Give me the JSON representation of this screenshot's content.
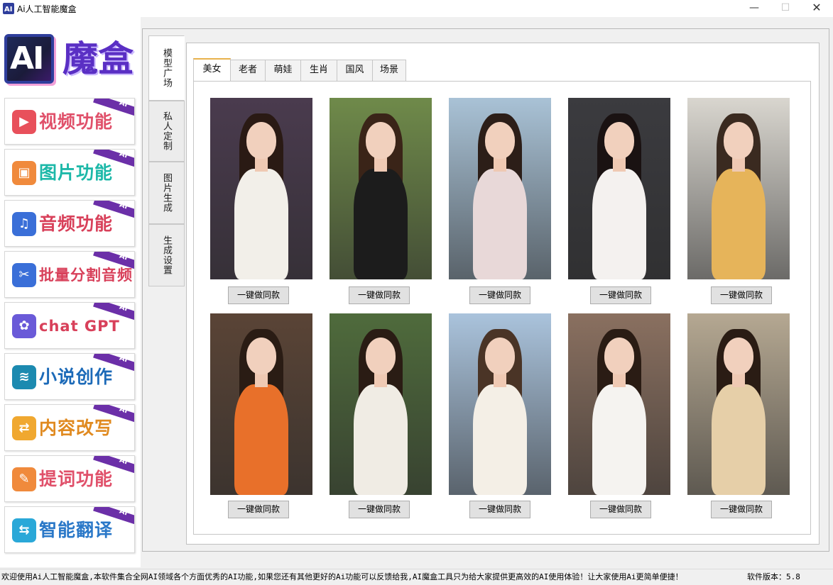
{
  "window": {
    "title": "Ai人工智能魔盒",
    "minimize_icon": "minimize-icon",
    "maximize_icon": "maximize-icon",
    "close_icon": "close-icon"
  },
  "logo": {
    "badge": "AI",
    "name": "魔盒"
  },
  "sidebar": {
    "badge": "AI",
    "items": [
      {
        "label": "视频功能",
        "icon": "video-icon",
        "color": "#e8505b",
        "text_color": "#e0506a"
      },
      {
        "label": "图片功能",
        "icon": "image-icon",
        "color": "#f08a3c",
        "text_color": "#1cb8a8"
      },
      {
        "label": "音频功能",
        "icon": "music-icon",
        "color": "#3a6fd8",
        "text_color": "#d8405a"
      },
      {
        "label": "批量分割音频",
        "icon": "split-audio-icon",
        "color": "#3a6fd8",
        "text_color": "#d8405a"
      },
      {
        "label": "chat GPT",
        "icon": "gpt-icon",
        "color": "#6a5ad8",
        "text_color": "#d8405a"
      },
      {
        "label": "小说创作",
        "icon": "novel-icon",
        "color": "#1c8ab0",
        "text_color": "#1c6ab8"
      },
      {
        "label": "内容改写",
        "icon": "rewrite-icon",
        "color": "#f0a830",
        "text_color": "#e08a20"
      },
      {
        "label": "提词功能",
        "icon": "prompt-icon",
        "color": "#f08a3c",
        "text_color": "#e0506a"
      },
      {
        "label": "智能翻译",
        "icon": "translate-icon",
        "color": "#2aa8d8",
        "text_color": "#2a78c8"
      }
    ]
  },
  "vertical_tabs": [
    "模型广场",
    "私人定制",
    "图片生成",
    "生成设置"
  ],
  "category_tabs": [
    "美女",
    "老者",
    "萌娃",
    "生肖",
    "国风",
    "场景"
  ],
  "gallery": {
    "button_label": "一键做同款",
    "items": [
      {
        "bg": "#4a3b4e",
        "hair": "#2a1a14",
        "outfit": "#f2efe9"
      },
      {
        "bg": "#6f8a4a",
        "hair": "#3a2418",
        "outfit": "#1c1c1c"
      },
      {
        "bg": "#a9c2d6",
        "hair": "#2c1e18",
        "outfit": "#e8d8d8"
      },
      {
        "bg": "#3b3b3f",
        "hair": "#1a1212",
        "outfit": "#f4f1ef"
      },
      {
        "bg": "#d9d6cf",
        "hair": "#3a2a20",
        "outfit": "#e6b45a"
      },
      {
        "bg": "#5a4436",
        "hair": "#2a1c14",
        "outfit": "#e8702a"
      },
      {
        "bg": "#4f6b3c",
        "hair": "#2a1c14",
        "outfit": "#f0ece4"
      },
      {
        "bg": "#aac3dc",
        "hair": "#4a3426",
        "outfit": "#f4efe6"
      },
      {
        "bg": "#8a7060",
        "hair": "#2a1c14",
        "outfit": "#f5f3f0"
      },
      {
        "bg": "#b5a892",
        "hair": "#2a1c14",
        "outfit": "#e6cfa8"
      }
    ]
  },
  "status": {
    "message": "欢迎使用Ai人工智能魔盒,本软件集合全网AI领域各个方面优秀的AI功能,如果您还有其他更好的Ai功能可以反馈给我,AI魔盒工具只为给大家提供更高效的AI使用体验！让大家使用Ai更简单便捷！",
    "version": "软件版本：5.8"
  }
}
